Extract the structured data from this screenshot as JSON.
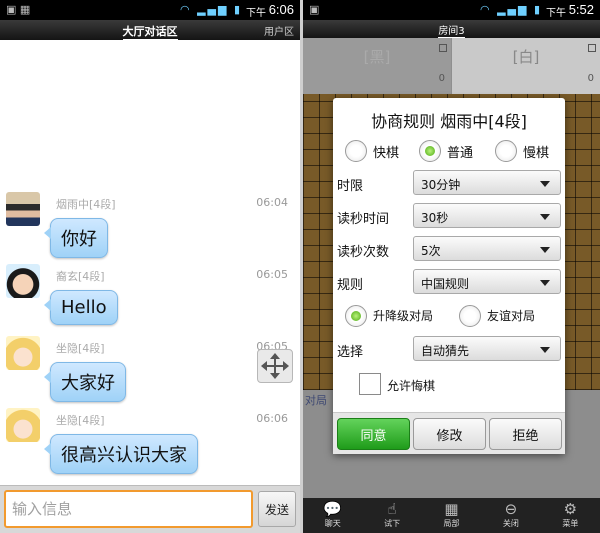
{
  "left": {
    "status": {
      "pm": "下午",
      "time": "6:06"
    },
    "title": "大厅对话区",
    "user_area": "用户区",
    "messages": [
      {
        "name": "烟雨中[4段]",
        "time": "06:04",
        "text": "你好"
      },
      {
        "name": "裔玄[4段]",
        "time": "06:05",
        "text": "Hello"
      },
      {
        "name": "坐隐[4段]",
        "time": "06:05",
        "text": "大家好"
      },
      {
        "name": "坐隐[4段]",
        "time": "06:06",
        "text": "很高兴认识大家"
      }
    ],
    "input_placeholder": "输入信息",
    "send_label": "发送"
  },
  "right": {
    "status": {
      "pm": "下午",
      "time": "5:52"
    },
    "room": "房间3",
    "black_label": "[黑]",
    "white_label": "[白]",
    "black_count": "0",
    "white_count": "0",
    "board_tag": "对局",
    "dialog": {
      "title": "协商规则  烟雨中[4段]",
      "speed_options": [
        "快棋",
        "普通",
        "慢棋"
      ],
      "speed_selected": "普通",
      "rows": [
        {
          "label": "时限",
          "value": "30分钟"
        },
        {
          "label": "读秒时间",
          "value": "30秒"
        },
        {
          "label": "读秒次数",
          "value": "5次"
        },
        {
          "label": "规则",
          "value": "中国规则"
        }
      ],
      "match_options": [
        "升降级对局",
        "友谊对局"
      ],
      "match_selected": "升降级对局",
      "choose_label": "选择",
      "choose_value": "自动猜先",
      "allow_undo_label": "允许悔棋",
      "allow_undo_checked": false,
      "buttons": {
        "agree": "同意",
        "modify": "修改",
        "refuse": "拒绝"
      }
    },
    "nav": [
      {
        "label": "聊天",
        "icon": "chat-bubble-icon"
      },
      {
        "label": "试下",
        "icon": "hand-pointer-icon"
      },
      {
        "label": "局部",
        "icon": "grid-icon"
      },
      {
        "label": "关闭",
        "icon": "minus-circle-icon"
      },
      {
        "label": "菜单",
        "icon": "gear-icon"
      }
    ]
  },
  "colors": {
    "bubble": "#a9d7f8",
    "input_border": "#f29a2e",
    "agree_green": "#2fae27",
    "board_wood": "#b88a3e",
    "radio_green": "#4aa90f"
  }
}
